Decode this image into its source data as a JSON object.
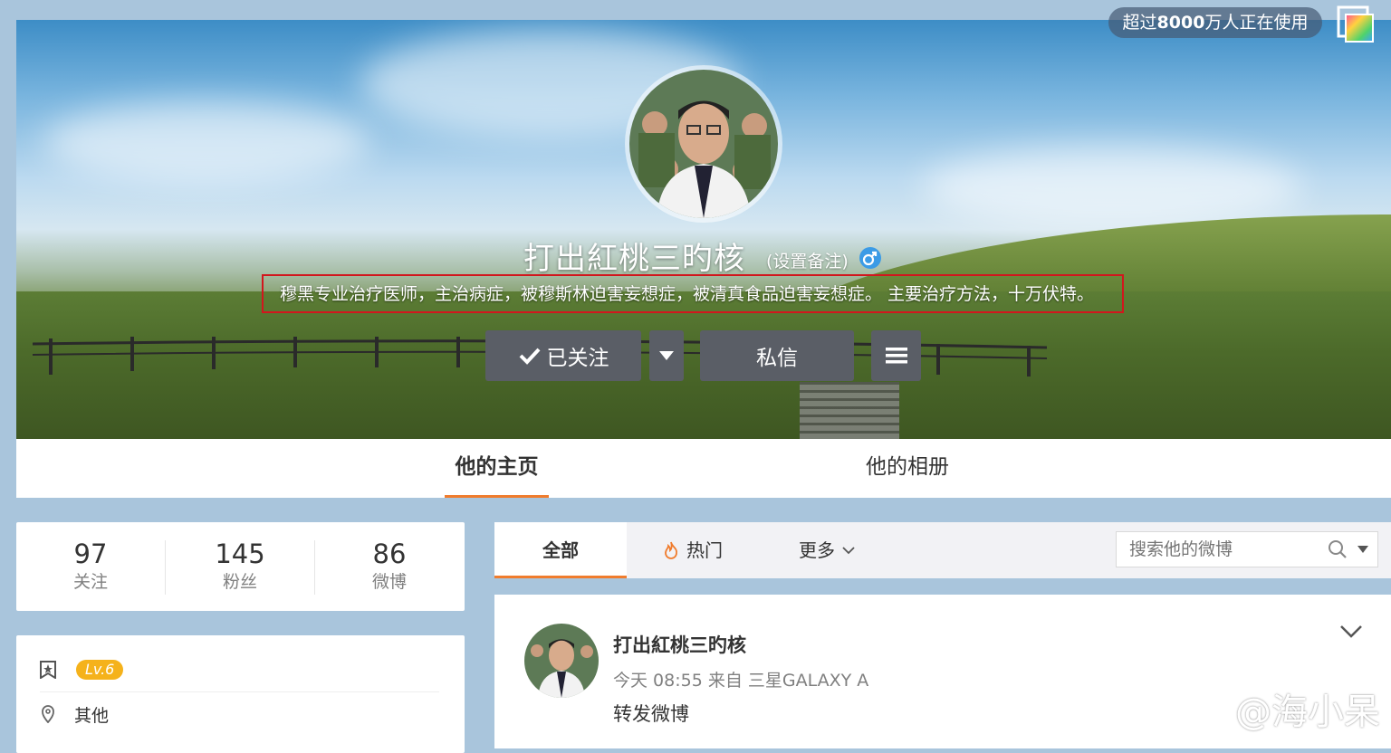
{
  "top_badge": {
    "prefix": "超过",
    "count": "8000",
    "suffix": "万人正在使用"
  },
  "profile": {
    "username": "打出紅桃三旳核",
    "remark": "(设置备注)",
    "bio": "穆黑专业治疗医师，主治病症，被穆斯林迫害妄想症，被清真食品迫害妄想症。 主要治疗方法，十万伏特。"
  },
  "actions": {
    "follow_label": "已关注",
    "message_label": "私信"
  },
  "tabs": [
    {
      "label": "他的主页"
    },
    {
      "label": "他的相册"
    }
  ],
  "stats": [
    {
      "num": "97",
      "label": "关注"
    },
    {
      "num": "145",
      "label": "粉丝"
    },
    {
      "num": "86",
      "label": "微博"
    }
  ],
  "info": {
    "level": "Lv.6",
    "location": "其他"
  },
  "feed_tabs": {
    "all": "全部",
    "hot": "热门",
    "more": "更多"
  },
  "search": {
    "placeholder": "搜索他的微博"
  },
  "post": {
    "author": "打出紅桃三旳核",
    "meta": "今天 08:55 来自 三星GALAXY A",
    "text": "转发微博"
  },
  "watermark": "@海小呆",
  "colors": {
    "accent": "#f07c2d",
    "button": "#5a5e66",
    "level_badge": "#f5b21b",
    "highlight_box": "#d2161d"
  }
}
